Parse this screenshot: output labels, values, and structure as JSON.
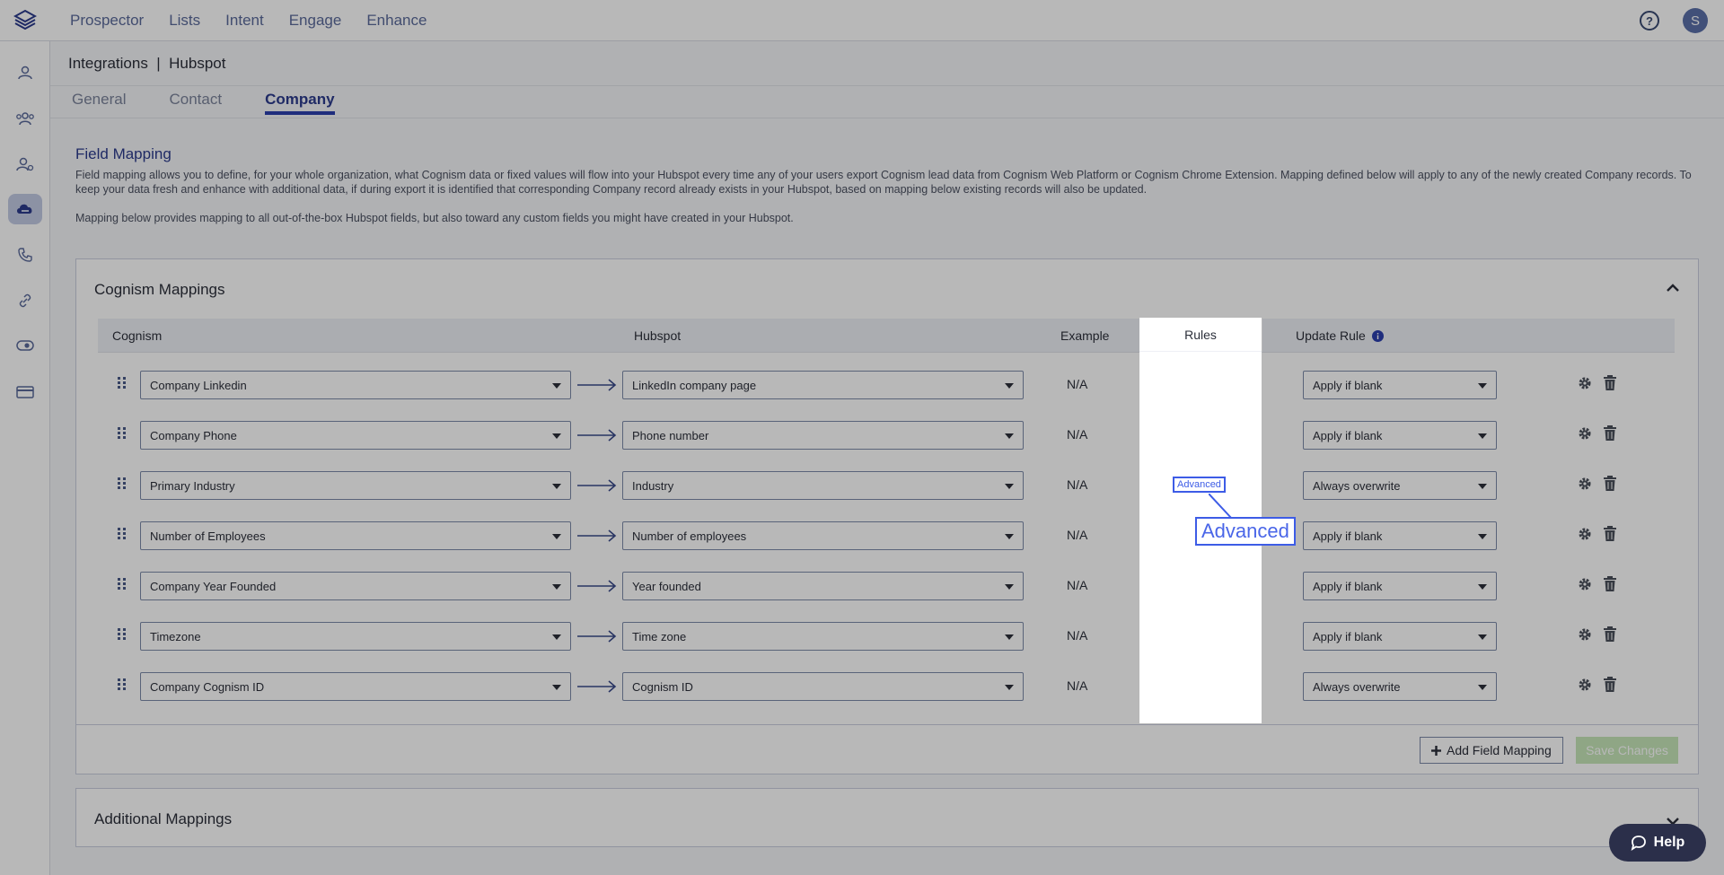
{
  "nav": {
    "items": [
      "Prospector",
      "Lists",
      "Intent",
      "Engage",
      "Enhance"
    ],
    "avatar_initial": "S",
    "help_glyph": "?"
  },
  "sidebar": {
    "icons": [
      "user-icon",
      "team-icon",
      "user-settings-icon",
      "cloud-integration-icon",
      "phone-icon",
      "link-icon",
      "eye-icon",
      "billing-card-icon"
    ],
    "active_index": 3
  },
  "header": {
    "breadcrumb": "Integrations  |  Hubspot",
    "tabs": [
      "General",
      "Contact",
      "Company"
    ],
    "active_tab": "Company"
  },
  "field_mapping": {
    "title": "Field Mapping",
    "description": "Field mapping allows you to define, for your whole organization, what Cognism data or fixed values will flow into your Hubspot every time any of your users export Cognism lead data from Cognism Web Platform or Cognism Chrome Extension. Mapping defined below will apply to any of the newly created Company records. To keep your data fresh and enhance with additional data, if during export it is identified that corresponding Company record already exists in your Hubspot, based on mapping below existing records will also be updated.",
    "description2": "Mapping below provides mapping to all out-of-the-box Hubspot fields, but also toward any custom fields you might have created in your Hubspot."
  },
  "cognism_mappings": {
    "title": "Cognism Mappings",
    "columns": {
      "cognism": "Cognism",
      "hubspot": "Hubspot",
      "example": "Example",
      "rules": "Rules",
      "update_rule": "Update Rule"
    },
    "rows": [
      {
        "cognism": "Company Linkedin",
        "hubspot": "LinkedIn company page",
        "example": "N/A",
        "update_rule": "Apply if blank"
      },
      {
        "cognism": "Company Phone",
        "hubspot": "Phone number",
        "example": "N/A",
        "update_rule": "Apply if blank"
      },
      {
        "cognism": "Primary Industry",
        "hubspot": "Industry",
        "example": "N/A",
        "update_rule": "Always overwrite"
      },
      {
        "cognism": "Number of Employees",
        "hubspot": "Number of employees",
        "example": "N/A",
        "update_rule": "Apply if blank"
      },
      {
        "cognism": "Company Year Founded",
        "hubspot": "Year founded",
        "example": "N/A",
        "update_rule": "Apply if blank"
      },
      {
        "cognism": "Timezone",
        "hubspot": "Time zone",
        "example": "N/A",
        "update_rule": "Apply if blank"
      },
      {
        "cognism": "Company Cognism ID",
        "hubspot": "Cognism ID",
        "example": "N/A",
        "update_rule": "Always overwrite"
      }
    ],
    "add_button": "Add Field Mapping",
    "save_button": "Save Changes"
  },
  "additional_mappings": {
    "title": "Additional Mappings"
  },
  "highlight": {
    "label_small": "Advanced",
    "label_big": "Advanced"
  },
  "help_widget": {
    "label": "Help"
  },
  "colors": {
    "accent": "#2c3fae",
    "highlight": "#3d5ce6",
    "save_disabled": "#c6e7b9"
  }
}
